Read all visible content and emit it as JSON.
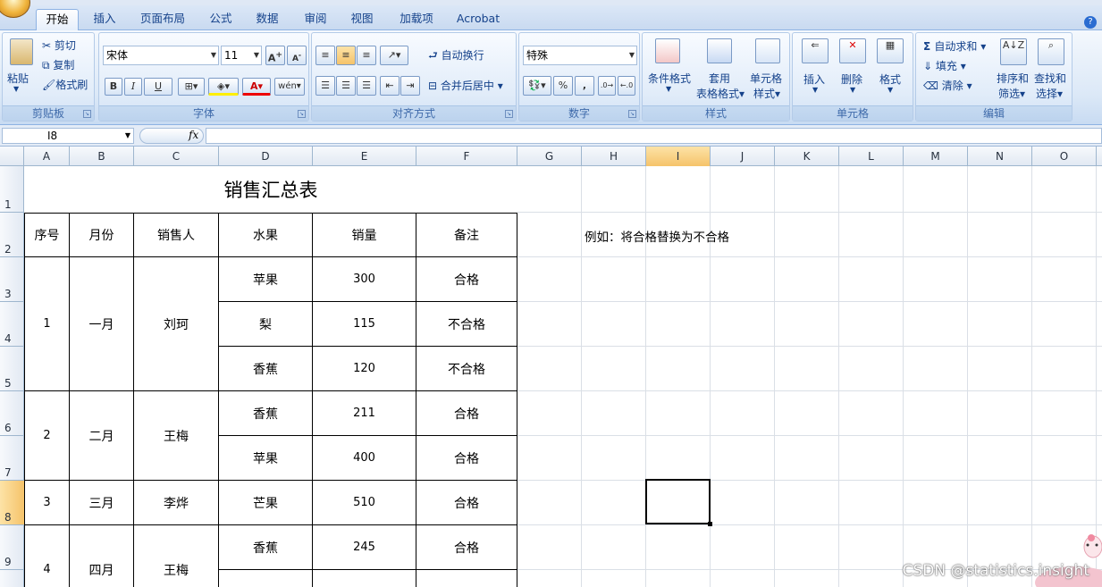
{
  "tabs": [
    "开始",
    "插入",
    "页面布局",
    "公式",
    "数据",
    "审阅",
    "视图",
    "加载项",
    "Acrobat"
  ],
  "clipboard": {
    "paste": "粘贴",
    "cut": "剪切",
    "copy": "复制",
    "format_painter": "格式刷",
    "group": "剪贴板"
  },
  "font": {
    "name": "宋体",
    "size": "11",
    "bold": "B",
    "italic": "I",
    "underline": "U",
    "group": "字体"
  },
  "alignment": {
    "wrap": "自动换行",
    "merge": "合并后居中",
    "group": "对齐方式"
  },
  "number": {
    "format": "特殊",
    "percent": "%",
    "comma": ",",
    "group": "数字"
  },
  "styles": {
    "conditional": "条件格式",
    "table_1": "套用",
    "table_2": "表格格式",
    "cell_1": "单元格",
    "cell_2": "样式",
    "group": "样式"
  },
  "cells": {
    "insert": "插入",
    "delete": "删除",
    "format": "格式",
    "group": "单元格"
  },
  "editing": {
    "autosum": "自动求和",
    "fill": "填充",
    "clear": "清除",
    "sort_1": "排序和",
    "sort_2": "筛选",
    "find_1": "查找和",
    "find_2": "选择",
    "group": "编辑"
  },
  "formula_bar": {
    "name_box": "I8",
    "fx": "fx"
  },
  "columns": [
    "A",
    "B",
    "C",
    "D",
    "E",
    "F",
    "G",
    "H",
    "I",
    "J",
    "K",
    "L",
    "M",
    "N",
    "O"
  ],
  "rows": [
    "1",
    "2",
    "3",
    "4",
    "5",
    "6",
    "7",
    "8",
    "9"
  ],
  "sheet": {
    "title": "销售汇总表",
    "headers": [
      "序号",
      "月份",
      "销售人",
      "水果",
      "销量",
      "备注"
    ],
    "groups": [
      {
        "no": "1",
        "month": "一月",
        "person": "刘珂"
      },
      {
        "no": "2",
        "month": "二月",
        "person": "王梅"
      },
      {
        "no": "3",
        "month": "三月",
        "person": "李烨"
      },
      {
        "no": "4",
        "month": "四月",
        "person": "王梅"
      }
    ],
    "items": [
      {
        "fruit": "苹果",
        "qty": "300",
        "note": "合格"
      },
      {
        "fruit": "梨",
        "qty": "115",
        "note": "不合格"
      },
      {
        "fruit": "香蕉",
        "qty": "120",
        "note": "不合格"
      },
      {
        "fruit": "香蕉",
        "qty": "211",
        "note": "合格"
      },
      {
        "fruit": "苹果",
        "qty": "400",
        "note": "合格"
      },
      {
        "fruit": "芒果",
        "qty": "510",
        "note": "合格"
      },
      {
        "fruit": "香蕉",
        "qty": "245",
        "note": "合格"
      }
    ],
    "note": "例如：将合格替换为不合格"
  },
  "watermark": "CSDN @statistics.insight"
}
